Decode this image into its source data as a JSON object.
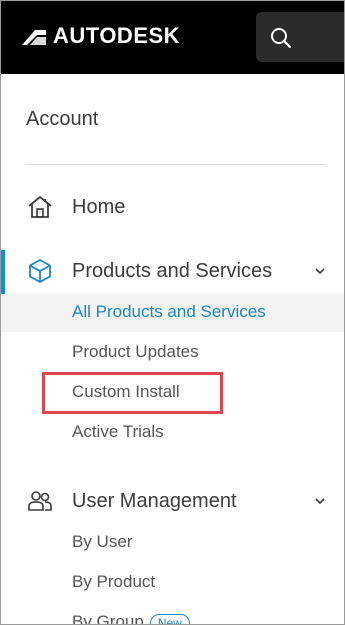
{
  "header": {
    "brand": "AUTODESK",
    "search_icon": "search-icon"
  },
  "sidebar": {
    "account_label": "Account",
    "home": {
      "label": "Home",
      "icon": "home-icon"
    },
    "products": {
      "label": "Products and Services",
      "icon": "cube-icon",
      "expanded": true,
      "items": [
        {
          "label": "All Products and Services",
          "active": true
        },
        {
          "label": "Product Updates"
        },
        {
          "label": "Custom Install",
          "highlighted": true
        },
        {
          "label": "Active Trials"
        }
      ]
    },
    "user_management": {
      "label": "User Management",
      "icon": "users-icon",
      "expanded": true,
      "items": [
        {
          "label": "By User"
        },
        {
          "label": "By Product"
        },
        {
          "label": "By Group",
          "badge": "New"
        }
      ]
    }
  },
  "colors": {
    "accent": "#0696d7",
    "link": "#1a86c8",
    "highlight": "#e0454f",
    "topbar": "#000000"
  }
}
